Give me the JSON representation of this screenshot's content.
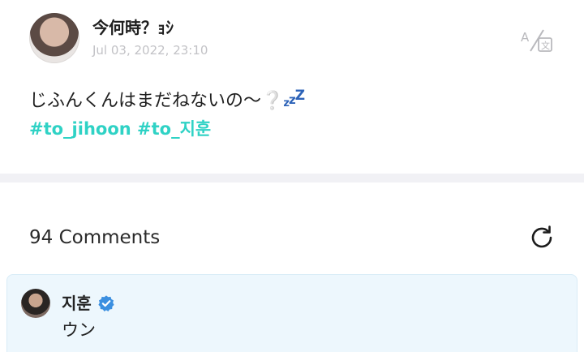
{
  "post": {
    "author": "今何時？ｮｼ",
    "timestamp": "Jul 03, 2022, 23:10",
    "text": "じふんくんはまだねないの〜❔",
    "zzz": [
      "z",
      "z",
      "Z"
    ],
    "hashtags": [
      "#to_jihoon",
      "#to_지훈"
    ]
  },
  "comments": {
    "count_label": "94 Comments",
    "items": [
      {
        "author": "지훈",
        "verified": true,
        "text": "ウン"
      }
    ]
  },
  "icons": {
    "translate": "translate-icon",
    "refresh": "refresh-icon",
    "verified": "verified-badge-icon"
  },
  "colors": {
    "hashtag": "#2fd2c5",
    "comment_bg": "#edf7fd",
    "verified": "#3b8fe0",
    "timestamp": "#c2c2c6"
  }
}
